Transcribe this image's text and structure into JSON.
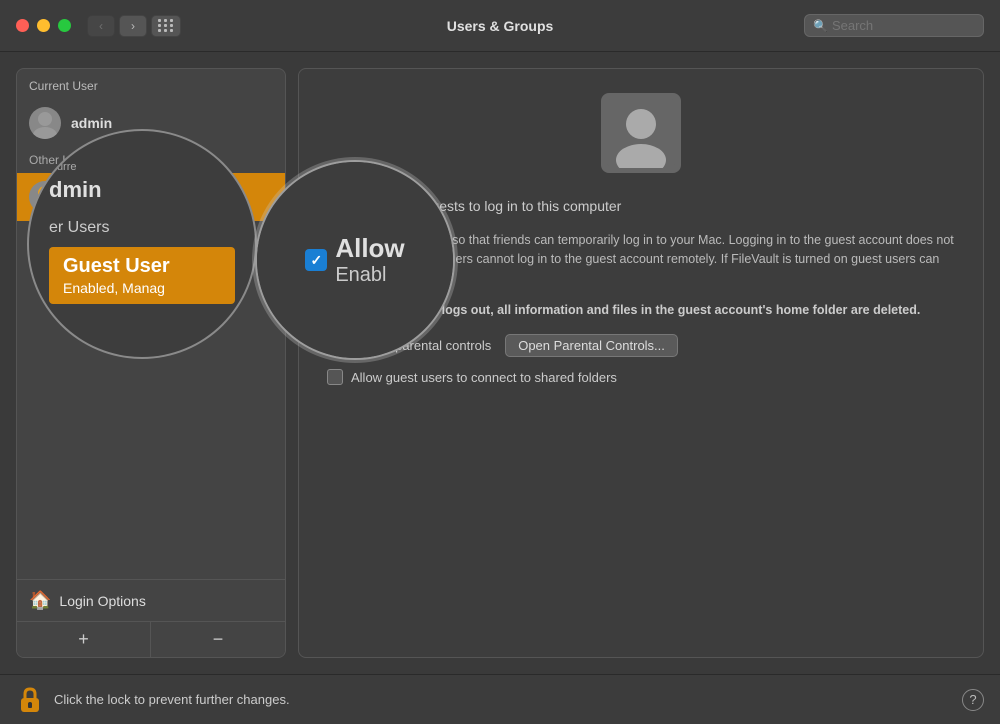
{
  "window": {
    "title": "Users & Groups",
    "search_placeholder": "Search"
  },
  "traffic_lights": {
    "close": "close",
    "minimize": "minimize",
    "maximize": "maximize"
  },
  "nav": {
    "back_label": "‹",
    "forward_label": "›"
  },
  "sidebar": {
    "header": "Current User",
    "items": [
      {
        "name": "admin",
        "role": "",
        "is_current": true
      },
      {
        "name": "Other Users",
        "role": "",
        "is_section": true
      },
      {
        "name": "Guest User",
        "role": "Enabled, Managed",
        "selected": true
      }
    ],
    "login_options_label": "Login Options",
    "add_label": "+",
    "remove_label": "−"
  },
  "detail": {
    "allow_title": "Allow",
    "allow_subtitle": "guests to log in to this computer",
    "description": "Enable the guest user so that friends can temporarily log in to your Mac. Logging in to the guest account does not require a password. Users cannot log in to the guest account remotely. If FileVault is turned on guest users can only access Safari.",
    "warning_bold": "When a guest user logs out, all information and files in the guest account's home folder are deleted.",
    "parental_controls_label": "Enable parental controls",
    "open_parental_btn": "Open Parental Controls...",
    "shared_folders_label": "Allow guest users to connect to shared folders"
  },
  "bottom_bar": {
    "lock_text": "Click the lock to prevent further changes.",
    "help_label": "?"
  },
  "magnifier": {
    "allow_large": "Allow",
    "enable_large": "Enabl"
  }
}
